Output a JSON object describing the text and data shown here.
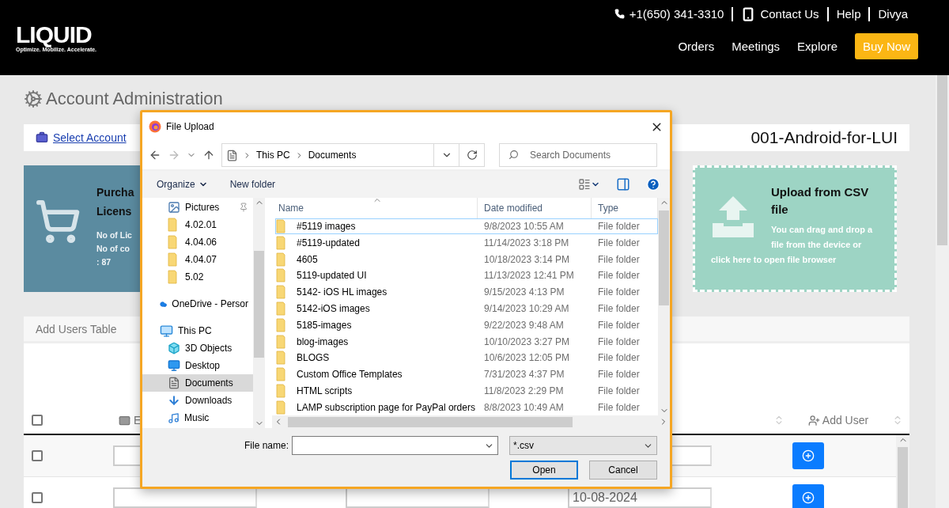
{
  "header": {
    "phone": "+1(650) 341-3310",
    "links": [
      {
        "label": "Contact Us",
        "kind": "contact"
      },
      {
        "label": "Help",
        "kind": "plain"
      },
      {
        "label": "Divya",
        "kind": "plain"
      }
    ],
    "logo": "LIQUID",
    "tagline": "Optimize. Mobilize. Accelerate.",
    "nav": [
      "Orders",
      "Meetings",
      "Explore"
    ],
    "cta": "Buy Now"
  },
  "page": {
    "title": "Account Administration",
    "breadcrumb": "Select Account",
    "account": "001-Android-for-LUI"
  },
  "purchase_card": {
    "title": [
      "Purcha",
      "Licens"
    ],
    "lines": [
      "No of Lic",
      "No of co",
      ": 87"
    ]
  },
  "upload_card": {
    "title": "Upload from CSV file",
    "text": "You can drag and drop a file from the device or click here to open file browser"
  },
  "table": {
    "title": "Add Users Table",
    "header_checkbox": {
      "checked": false
    },
    "columns": [
      {
        "label": "E",
        "kind": "email"
      },
      {
        "label": "Add User",
        "kind": "add"
      }
    ],
    "rows": [
      {
        "checked": false,
        "cells": [
          {
            "kind": "input"
          },
          {
            "kind": "hidden"
          },
          {
            "kind": "input"
          }
        ]
      },
      {
        "checked": false,
        "cells": [
          {
            "kind": "input"
          },
          {
            "kind": "input"
          },
          {
            "kind": "input",
            "value": "10-08-2024"
          }
        ]
      }
    ]
  },
  "dialog": {
    "title": "File Upload",
    "path": [
      "This PC",
      "Documents"
    ],
    "search_placeholder": "Search Documents",
    "toolbar": [
      "Organize",
      "New folder"
    ],
    "tree": {
      "quick": [
        {
          "label": "Pictures",
          "kind": "pictures",
          "pinned": true,
          "selected": false
        },
        {
          "label": "4.02.01",
          "kind": "folder",
          "pinned": false,
          "selected": false
        },
        {
          "label": "4.04.06",
          "kind": "folder",
          "pinned": false,
          "selected": false
        },
        {
          "label": "4.04.07",
          "kind": "folder",
          "pinned": false,
          "selected": false
        },
        {
          "label": "5.02",
          "kind": "folder",
          "pinned": false,
          "selected": false
        }
      ],
      "locations": [
        {
          "label": "OneDrive - Persor",
          "kind": "onedrive",
          "selected": false
        },
        {
          "label": "This PC",
          "kind": "pc",
          "selected": false,
          "children": [
            {
              "label": "3D Objects",
              "kind": "objects",
              "selected": false
            },
            {
              "label": "Desktop",
              "kind": "desktop",
              "selected": false
            },
            {
              "label": "Documents",
              "kind": "documents",
              "selected": true
            },
            {
              "label": "Downloads",
              "kind": "downloads",
              "selected": false
            },
            {
              "label": "Music",
              "kind": "music",
              "selected": false
            }
          ]
        }
      ]
    },
    "columns": [
      "Name",
      "Date modified",
      "Type"
    ],
    "files": [
      {
        "name": "#5119 images",
        "date": "9/8/2023 10:55 AM",
        "type": "File folder",
        "selected": true
      },
      {
        "name": "#5119-updated",
        "date": "11/14/2023 3:18 PM",
        "type": "File folder",
        "selected": false
      },
      {
        "name": "4605",
        "date": "10/18/2023 3:14 PM",
        "type": "File folder",
        "selected": false
      },
      {
        "name": "5119-updated UI",
        "date": "11/13/2023 12:41 PM",
        "type": "File folder",
        "selected": false
      },
      {
        "name": "5142- iOS HL images",
        "date": "9/15/2023 4:13 PM",
        "type": "File folder",
        "selected": false
      },
      {
        "name": "5142-iOS images",
        "date": "9/14/2023 10:29 AM",
        "type": "File folder",
        "selected": false
      },
      {
        "name": "5185-images",
        "date": "9/22/2023 9:48 AM",
        "type": "File folder",
        "selected": false
      },
      {
        "name": "blog-images",
        "date": "10/10/2023 3:27 PM",
        "type": "File folder",
        "selected": false
      },
      {
        "name": "BLOGS",
        "date": "10/6/2023 12:05 PM",
        "type": "File folder",
        "selected": false
      },
      {
        "name": "Custom Office Templates",
        "date": "7/31/2023 4:37 PM",
        "type": "File folder",
        "selected": false
      },
      {
        "name": "HTML scripts",
        "date": "11/8/2023 2:29 PM",
        "type": "File folder",
        "selected": false
      },
      {
        "name": "LAMP subscription page for PayPal orders",
        "date": "8/8/2023 10:49 AM",
        "type": "File folder",
        "selected": false
      }
    ],
    "file_name_label": "File name:",
    "filter": "*.csv",
    "buttons": [
      "Open",
      "Cancel"
    ]
  }
}
